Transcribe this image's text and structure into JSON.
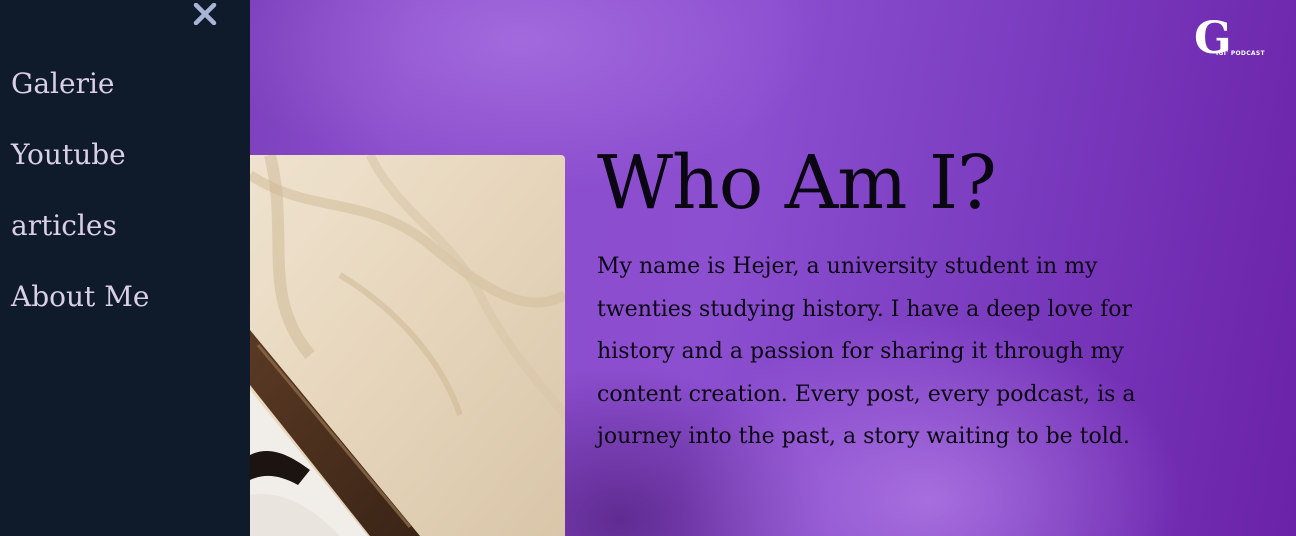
{
  "sidebar": {
    "items": [
      {
        "label": "Galerie"
      },
      {
        "label": "Youtube"
      },
      {
        "label": "articles"
      },
      {
        "label": "About Me"
      }
    ]
  },
  "logo": {
    "mark": "G",
    "text": "IGI' PODCAST"
  },
  "about": {
    "title": "Who Am I?",
    "bio": "My name is Hejer, a university student in my twenties studying history. I have a deep love for history and a passion for sharing it through my content creation. Every post, every podcast, is a journey into the past, a story waiting to be told."
  },
  "colors": {
    "sidebar_bg": "#0f1a2b",
    "accent_purple": "#8c4fd0",
    "nav_text": "#d9cfe6",
    "close_icon": "#a7b4d6"
  },
  "icons": {
    "close": "close-icon"
  }
}
